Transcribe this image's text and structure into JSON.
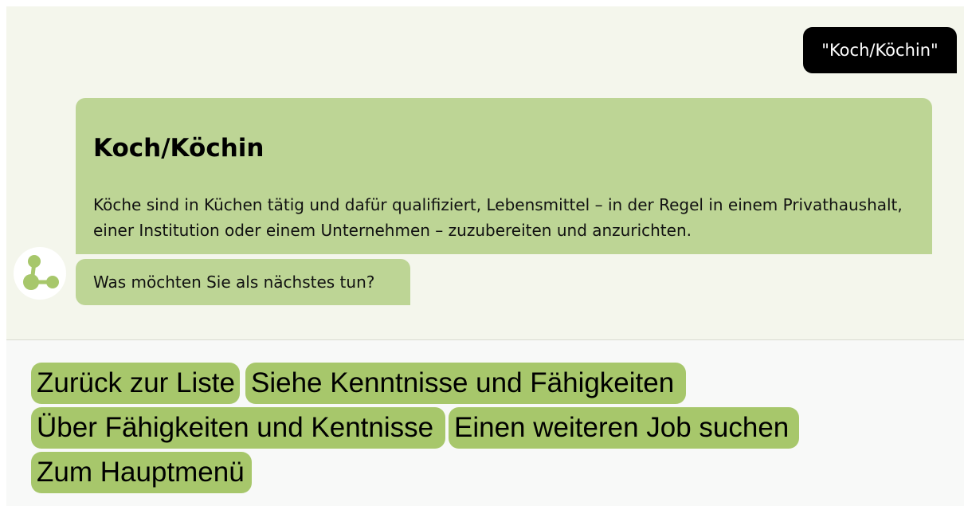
{
  "user_message": "\"Koch/Köchin\"",
  "bot_card": {
    "title": "Koch/Köchin",
    "description": "Köche sind in Küchen tätig und dafür qualifiziert, Lebensmittel – in der Regel in einem Privathaushalt, einer Institution oder einem Unternehmen – zuzubereiten und anzurichten."
  },
  "bot_prompt": "Was möchten Sie als nächstes tun?",
  "avatar_icon": "network-nodes-icon",
  "colors": {
    "chat_background": "#f4f6ec",
    "bot_bubble": "#bdd595",
    "action_button": "#a7c76b",
    "user_bubble": "#000000"
  },
  "actions": [
    {
      "label": "Zurück zur Liste"
    },
    {
      "label": "Siehe Kenntnisse und Fähigkeiten"
    },
    {
      "label": "Über Fähigkeiten und Kentnisse"
    },
    {
      "label": "Einen weiteren Job suchen"
    },
    {
      "label": "Zum Hauptmenü"
    }
  ]
}
